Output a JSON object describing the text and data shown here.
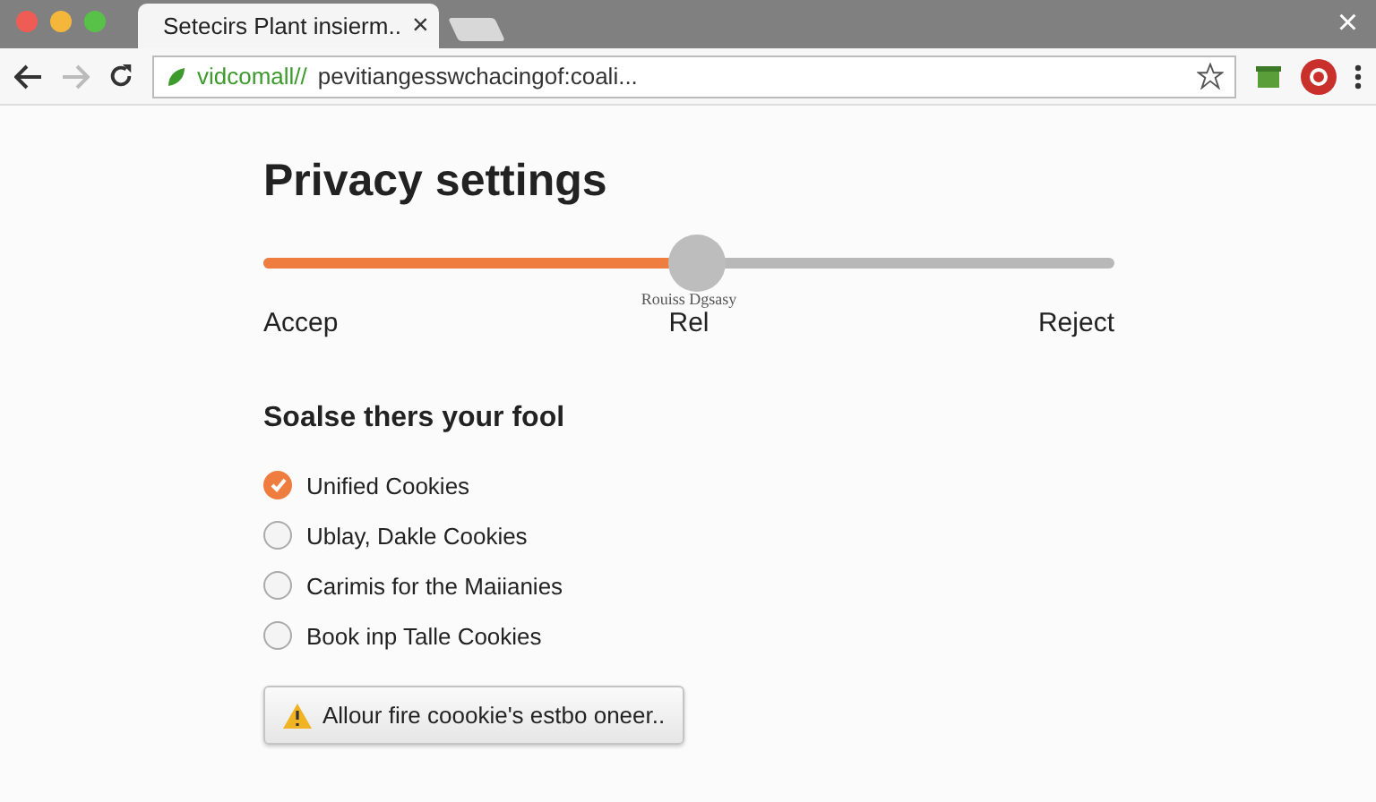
{
  "browser": {
    "tab_title": "Setecirs Plant insierm..",
    "tab_close": "×",
    "window_close": "×",
    "url_scheme": "vidcomall//",
    "url_rest": "pevitiangesswchacingof:coali..."
  },
  "page": {
    "title": "Privacy settings",
    "slider": {
      "level": 0.51,
      "thumb_label": "Rouiss Dgsasy",
      "labels": [
        "Accep",
        "Rel",
        "Reject"
      ]
    },
    "section_title": "Soalse thers your fool",
    "options": [
      {
        "label": "Unified Cookies",
        "selected": true
      },
      {
        "label": "Ublay, Dakle Cookies",
        "selected": false
      },
      {
        "label": "Carimis for the Maiianies",
        "selected": false
      },
      {
        "label": "Book inp Talle Cookies",
        "selected": false
      }
    ],
    "button": "Allour fire coookie's estbo oneer.."
  }
}
